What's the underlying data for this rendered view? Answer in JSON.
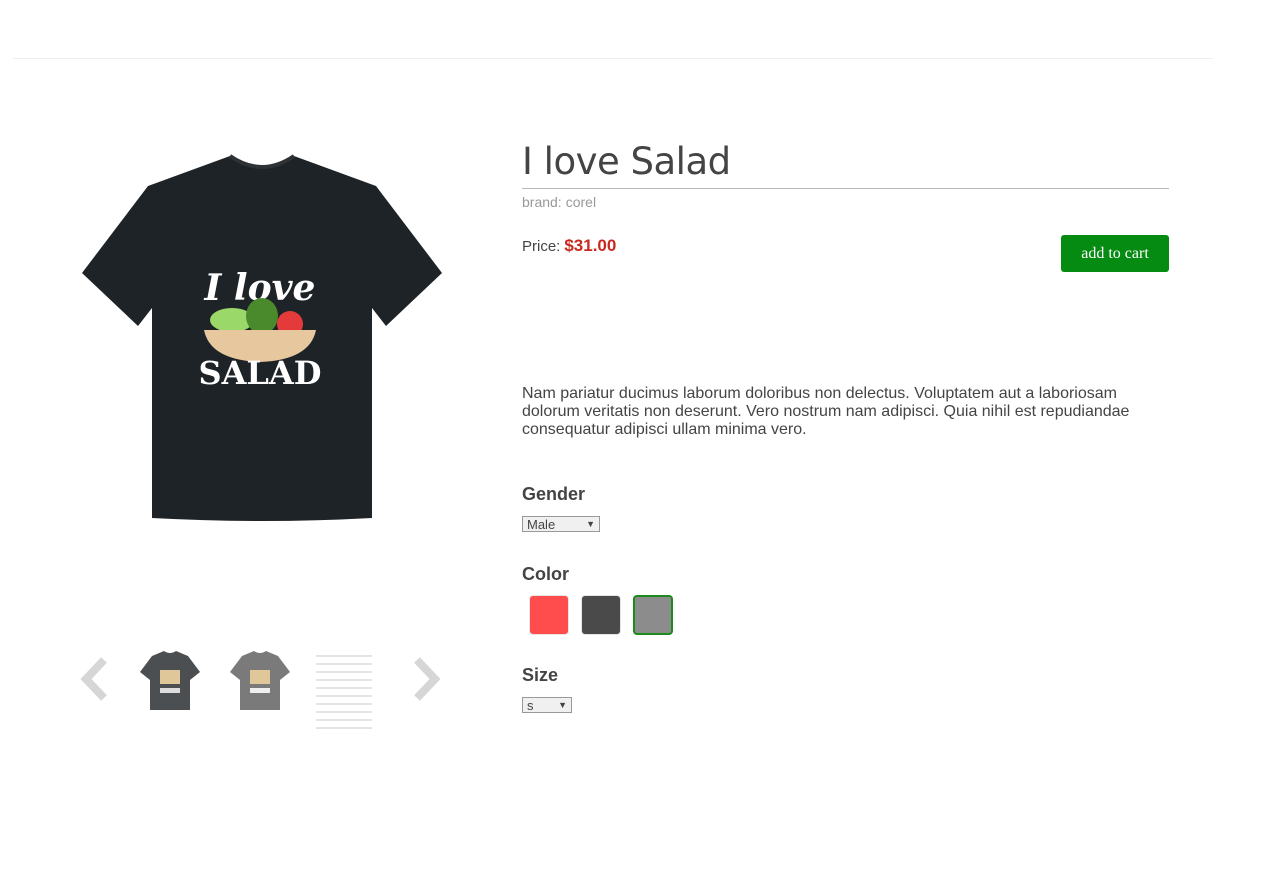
{
  "product": {
    "title": "I love Salad",
    "brand_label": "brand:",
    "brand": "corel",
    "price_label": "Price:",
    "price": "$31.00",
    "add_to_cart": "add to cart",
    "description": "Nam pariatur ducimus laborum doloribus non delectus. Voluptatem aut a laboriosam dolorum veritatis non deserunt. Vero nostrum nam adipisci. Quia nihil est repudiandae consequatur adipisci ullam minima vero.",
    "image_text_top": "I love",
    "image_text_bottom": "SALAD"
  },
  "options": {
    "gender": {
      "label": "Gender",
      "selected": "Male"
    },
    "color": {
      "label": "Color",
      "swatches": [
        "#ff4d4d",
        "#4a4a4a",
        "#8c8c8c"
      ],
      "selected_index": 2
    },
    "size": {
      "label": "Size",
      "selected": "s"
    }
  },
  "gallery": {
    "thumbnails": [
      "dark-gray-shirt",
      "gray-shirt",
      "size-chart"
    ],
    "prev_icon": "chevron-left-icon",
    "next_icon": "chevron-right-icon"
  },
  "colors": {
    "price": "#c8281e",
    "cart_button": "#058a12",
    "shirt": "#1e2327"
  }
}
